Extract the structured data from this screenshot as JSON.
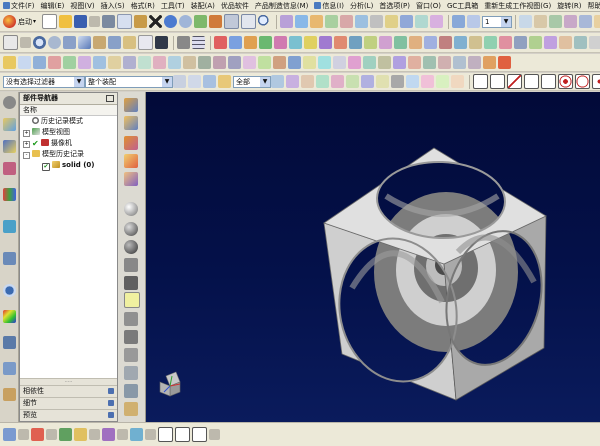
{
  "menubar": {
    "items": [
      "文件(F)",
      "编辑(E)",
      "视图(V)",
      "插入(S)",
      "格式(R)",
      "工具(T)",
      "装配(A)",
      "优品软件",
      "产品制造信息(M)",
      "信息(I)",
      "分析(L)",
      "首选项(P)",
      "窗口(O)",
      "GC工具箱",
      "重新生成工作视图(G)",
      "旋转(R)",
      "帮助"
    ]
  },
  "toolbar1": {
    "start_label": "启动",
    "layer_value": "1"
  },
  "filterbar": {
    "selection_filter": "没有选择过滤器",
    "scope": "整个装配",
    "snap_mode": "全部"
  },
  "navigator": {
    "title": "部件导航器",
    "column_name": "名称",
    "nodes": [
      {
        "label": "历史记录模式",
        "expander": ""
      },
      {
        "label": "模型视图",
        "expander": "+"
      },
      {
        "label": "摄像机",
        "expander": "+"
      },
      {
        "label": "模型历史记录",
        "expander": "-"
      },
      {
        "label": "solid (0)",
        "expander": ""
      }
    ],
    "footer": [
      "相依性",
      "细节",
      "预览"
    ]
  },
  "colors": {
    "viewport_top": "#020a38",
    "cube_face_light": "#d6d6d6",
    "cube_face_mid": "#b9b9b9",
    "cube_face_dark": "#8a8a8a"
  },
  "icons": [
    "nx-logo-icon",
    "new-file-icon",
    "open-folder-icon",
    "save-icon",
    "cut-icon",
    "copy-icon",
    "paste-icon",
    "delete-icon",
    "undo-icon",
    "redo-icon",
    "find-icon",
    "triad-icon"
  ]
}
